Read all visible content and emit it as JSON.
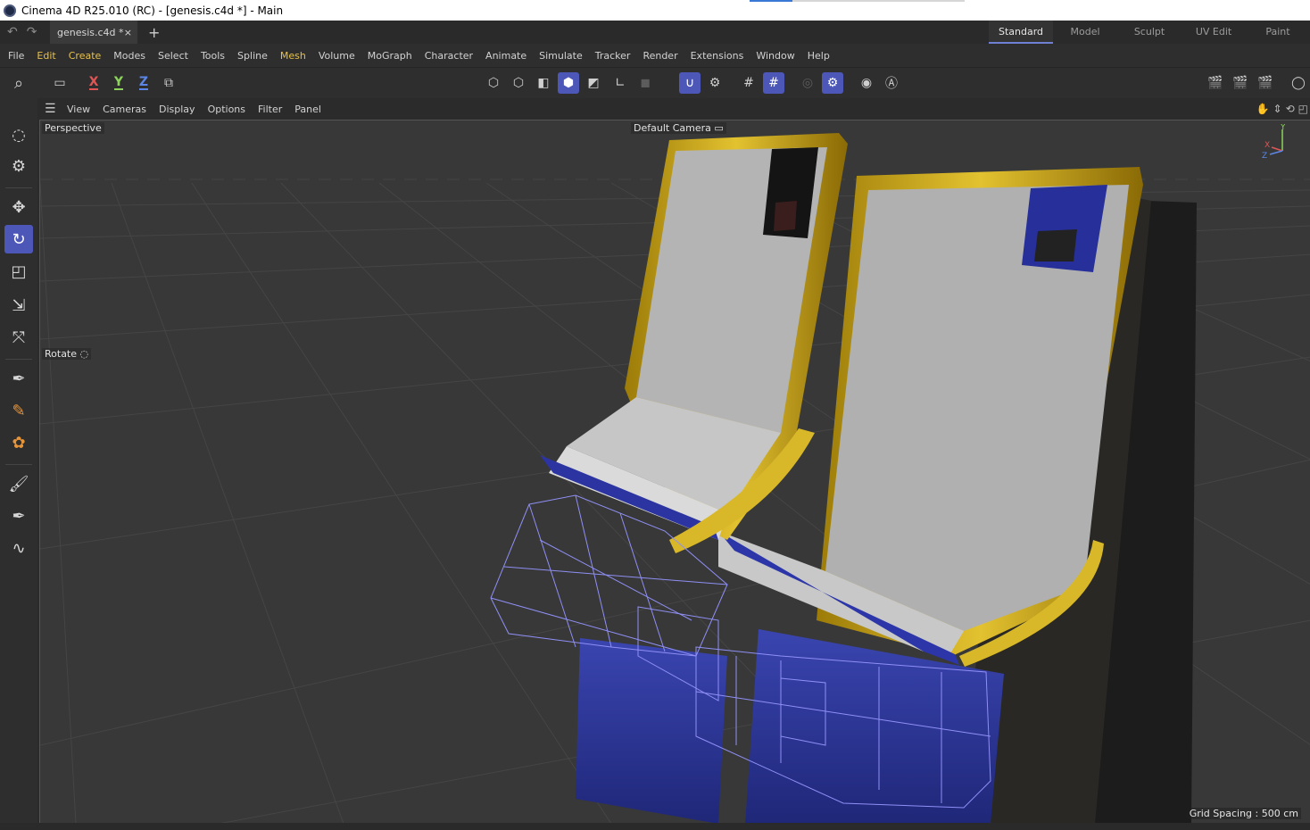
{
  "window": {
    "title": "Cinema 4D R25.010 (RC) - [genesis.c4d *] - Main"
  },
  "tabs": {
    "document": "genesis.c4d *",
    "close_glyph": "×",
    "add_glyph": "+"
  },
  "layouts": [
    "Standard",
    "Model",
    "Sculpt",
    "UV Edit",
    "Paint"
  ],
  "active_layout": "Standard",
  "menu": [
    "File",
    "Edit",
    "Create",
    "Modes",
    "Select",
    "Tools",
    "Spline",
    "Mesh",
    "Volume",
    "MoGraph",
    "Character",
    "Animate",
    "Simulate",
    "Tracker",
    "Render",
    "Extensions",
    "Window",
    "Help"
  ],
  "highlighted_menus": [
    "Edit",
    "Create",
    "Mesh"
  ],
  "toolbar": {
    "axis_x": "X",
    "axis_y": "Y",
    "axis_z": "Z"
  },
  "viewport_menu": [
    "View",
    "Cameras",
    "Display",
    "Options",
    "Filter",
    "Panel"
  ],
  "viewport": {
    "projection": "Perspective",
    "camera": "Default Camera",
    "active_tool": "Rotate",
    "grid_spacing": "Grid Spacing : 500 cm",
    "axis_labels": {
      "x": "X",
      "y": "Y",
      "z": "Z"
    }
  },
  "colors": {
    "accent": "#4c57b8",
    "menu_highlight": "#e8c14a",
    "cabinet_gold": "#c8a316",
    "cabinet_blue": "#2f3a9a",
    "screen_gray": "#b4b4b4",
    "wireframe": "#8f8ff5"
  }
}
